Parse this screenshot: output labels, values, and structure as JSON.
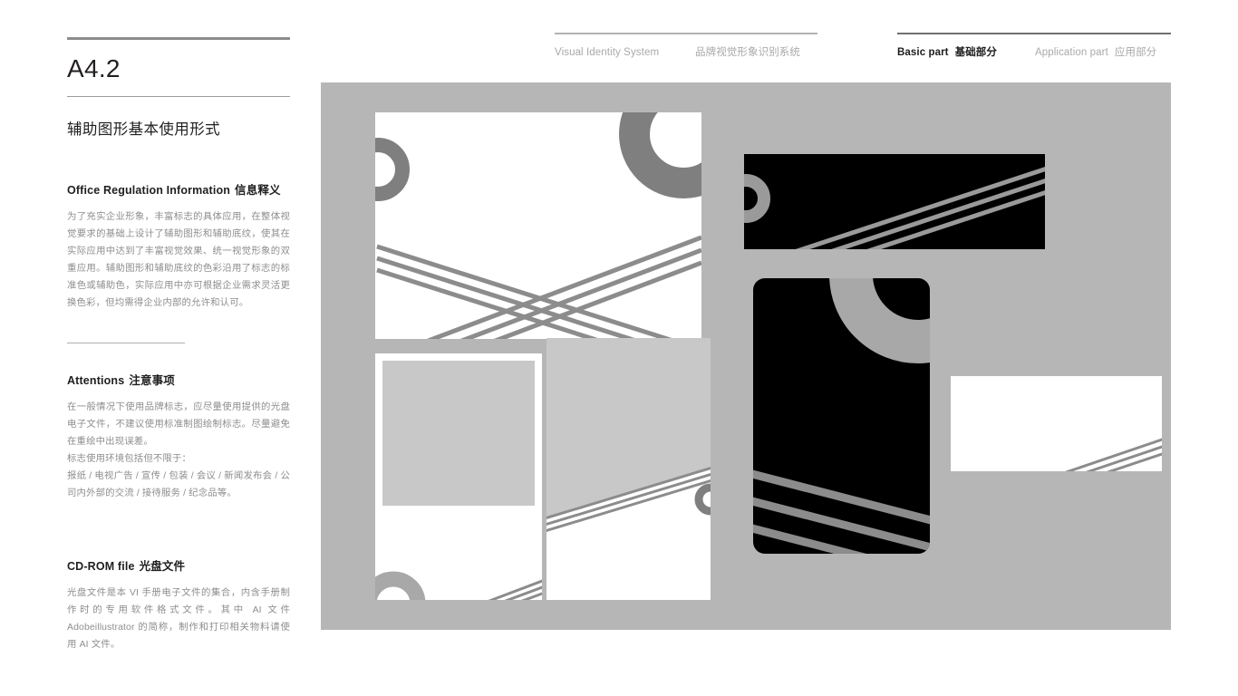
{
  "header": {
    "groups": [
      {
        "id": "visual-identity",
        "active": false,
        "items": [
          {
            "en": "Visual Identity System",
            "cn": ""
          },
          {
            "en": "",
            "cn": "品牌视觉形象识别系统"
          }
        ]
      },
      {
        "id": "parts",
        "items": [
          {
            "en": "Basic part",
            "cn": "基础部分",
            "active": true
          },
          {
            "en": "Application part",
            "cn": "应用部分",
            "active": false
          }
        ]
      }
    ]
  },
  "left": {
    "doc_code": "A4.2",
    "subtitle": "辅助图形基本使用形式",
    "sections": [
      {
        "id": "office-regulation-information",
        "head_en": "Office Regulation Information",
        "head_cn": "信息释义",
        "body": "为了充实企业形象，丰富标志的具体应用，在整体视觉要求的基础上设计了辅助图形和辅助底纹，使其在实际应用中达到了丰富视觉效果、统一视觉形象的双重应用。辅助图形和辅助底纹的色彩沿用了标志的标准色或辅助色，实际应用中亦可根据企业需求灵活更换色彩，但均需得企业内部的允许和认可。"
      },
      {
        "id": "attentions",
        "head_en": "Attentions",
        "head_cn": "注意事项",
        "body_1": "在一般情况下使用品牌标志，应尽量使用提供的光盘电子文件，不建议使用标准制图绘制标志。尽量避免在重绘中出现误差。",
        "body_2": "标志使用环境包括但不限于：",
        "body_3": "报纸 / 电视广告 / 宣传 / 包装 / 会议 / 新闻发布会 / 公司内外部的交流 / 接待服务 / 纪念品等。"
      },
      {
        "id": "cd-rom-file",
        "head_en": "CD-ROM file",
        "head_cn": "光盘文件",
        "body": "光盘文件是本 VI 手册电子文件的集合，内含手册制作时的专用软件格式文件。其中 AI 文件 Adobeillustrator 的简称，制作和打印相关物料请使用 AI 文件。"
      }
    ]
  },
  "panel": {
    "background_color": "#b6b6b6",
    "cards": [
      {
        "id": "card-tl",
        "kind": "white-landscape",
        "motifs": [
          "ring-left-clip",
          "ring-top-right-clip",
          "crossing-stripes"
        ]
      },
      {
        "id": "card-black-h",
        "kind": "black-landscape",
        "motifs": [
          "ring-left-clip",
          "diagonal-stripes"
        ]
      },
      {
        "id": "card-black-v",
        "kind": "black-portrait",
        "motifs": [
          "quarter-ring-top-right",
          "diagonal-stripes-bottom"
        ]
      },
      {
        "id": "card-bl",
        "kind": "white-portrait",
        "motifs": [
          "gray-block",
          "ring-bottom-left-clip",
          "diagonal-stripes-corner"
        ]
      },
      {
        "id": "card-bm",
        "kind": "white-portrait",
        "motifs": [
          "gray-diagonal-fill",
          "diagonal-stripes",
          "ring-right-clip"
        ]
      },
      {
        "id": "card-r",
        "kind": "white-landscape",
        "motifs": [
          "diagonal-stripes-corner"
        ]
      }
    ],
    "colors": {
      "stripe": "#8c8c8c",
      "light_stripe": "#a8a8a8",
      "ring": "#7f7f7f",
      "ring_light": "#a8a8a8",
      "gray_block": "#c8c8c8",
      "black": "#000000",
      "white": "#ffffff"
    }
  }
}
